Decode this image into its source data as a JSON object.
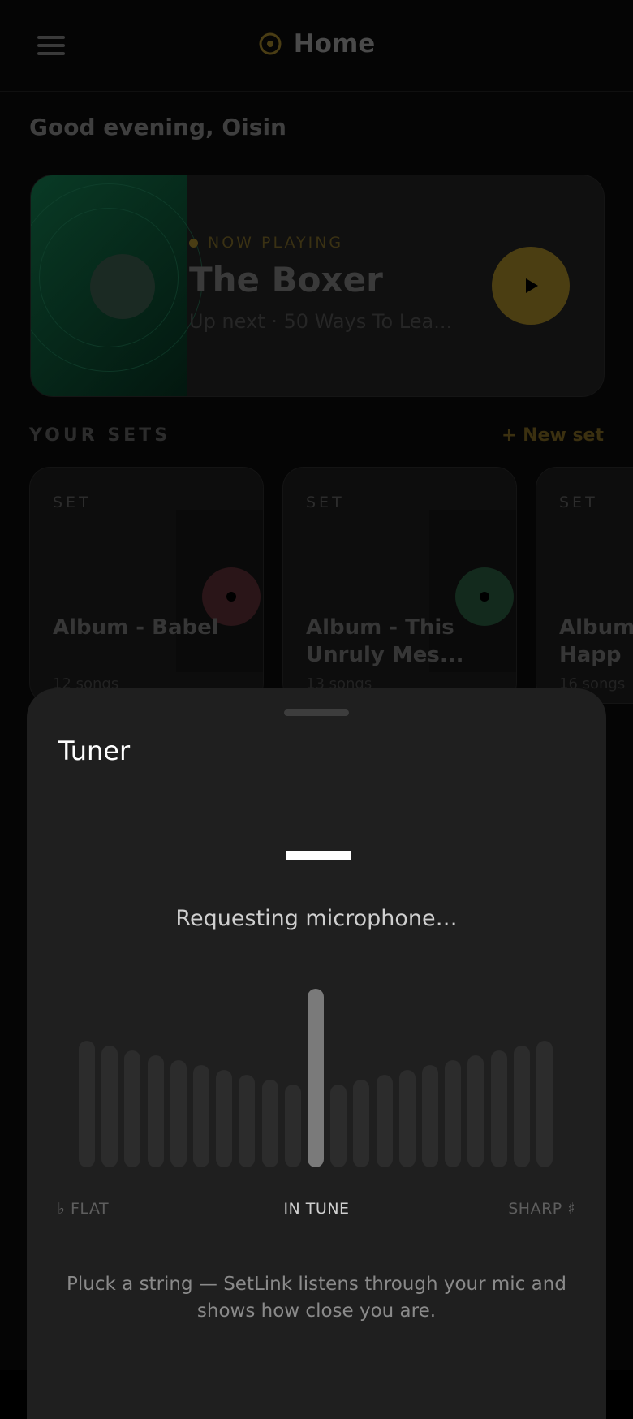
{
  "header": {
    "title": "Home",
    "menu_icon": "hamburger-menu-icon",
    "title_icon": "target-icon",
    "accent": "#4a3d14"
  },
  "greeting": "Good evening, Oisin",
  "now_playing": {
    "label": "NOW PLAYING",
    "title": "The Boxer",
    "subtitle": "Up next · 50 Ways To Lea...",
    "play_icon": "play-icon"
  },
  "sets": {
    "heading": "YOUR SETS",
    "new_set": "+ New set",
    "items": [
      {
        "tag": "SET",
        "title": "Album - Babel",
        "count": "12 songs",
        "disc_color": "#2a1518"
      },
      {
        "tag": "SET",
        "title": "Album - This Unruly Mes...",
        "count": "13 songs",
        "disc_color": "#132a1d"
      },
      {
        "tag": "SET",
        "title": "Album - Happ",
        "count": "16 songs",
        "disc_color": "#1a1a1a"
      }
    ]
  },
  "tuner": {
    "title": "Tuner",
    "note": "—",
    "status": "Requesting microphone…",
    "level_cents": 0,
    "flat_label": "♭ FLAT",
    "in_tune_label": "IN TUNE",
    "sharp_label": "SHARP ♯",
    "hint": "Pluck a string — SetLink listens through your mic and shows how close you are."
  }
}
